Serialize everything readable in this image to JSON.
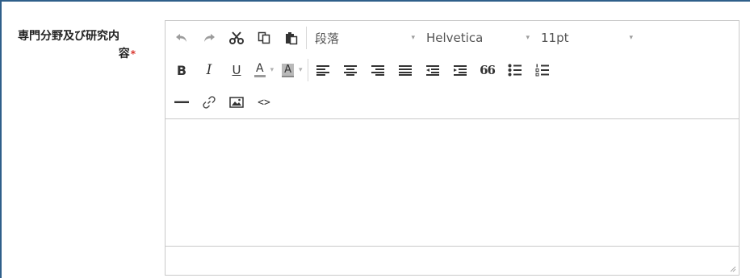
{
  "field": {
    "label_line1": "専門分野及び研究内",
    "label_line2": "容",
    "required_mark": "*"
  },
  "toolbar": {
    "paragraph_select": "段落",
    "font_select": "Helvetica",
    "size_select": "11pt",
    "bold": "B",
    "italic": "I",
    "underline": "U",
    "text_color": "A",
    "bg_color": "A",
    "caret": "▾",
    "code_view": "<>",
    "blockquote": "66"
  },
  "colors": {
    "frame_border": "#2f5f8a",
    "required": "#d8342c",
    "editor_border": "#c9c9c9",
    "icon": "#444444"
  }
}
